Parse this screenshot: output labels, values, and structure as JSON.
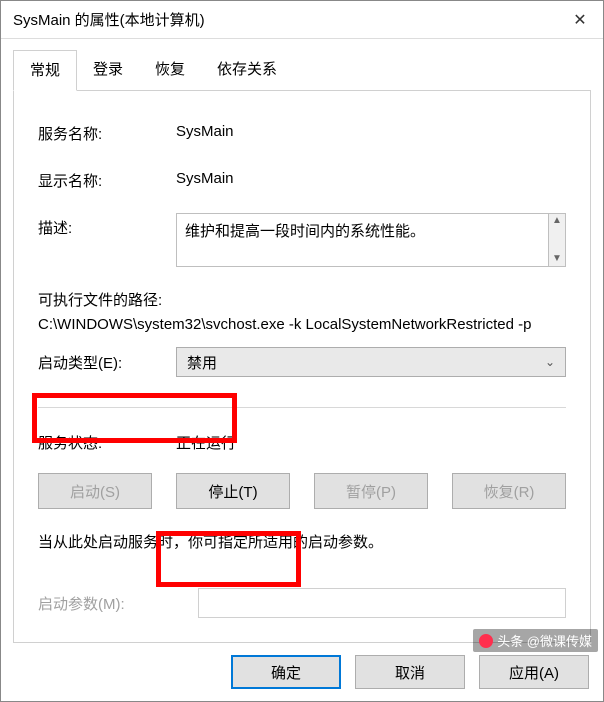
{
  "window": {
    "title": "SysMain 的属性(本地计算机)"
  },
  "tabs": {
    "general": "常规",
    "logon": "登录",
    "recovery": "恢复",
    "dependencies": "依存关系"
  },
  "fields": {
    "service_name_label": "服务名称:",
    "service_name_value": "SysMain",
    "display_name_label": "显示名称:",
    "display_name_value": "SysMain",
    "description_label": "描述:",
    "description_value": "维护和提高一段时间内的系统性能。",
    "path_label": "可执行文件的路径:",
    "path_value": "C:\\WINDOWS\\system32\\svchost.exe -k LocalSystemNetworkRestricted -p",
    "startup_type_label": "启动类型(E):",
    "startup_type_value": "禁用",
    "status_label": "服务状态:",
    "status_value": "正在运行",
    "hint_text": "当从此处启动服务时，你可指定所适用的启动参数。",
    "params_label": "启动参数(M):",
    "params_value": ""
  },
  "service_buttons": {
    "start": "启动(S)",
    "stop": "停止(T)",
    "pause": "暂停(P)",
    "resume": "恢复(R)"
  },
  "dialog_buttons": {
    "ok": "确定",
    "cancel": "取消",
    "apply": "应用(A)"
  },
  "watermark": "头条 @微课传媒"
}
